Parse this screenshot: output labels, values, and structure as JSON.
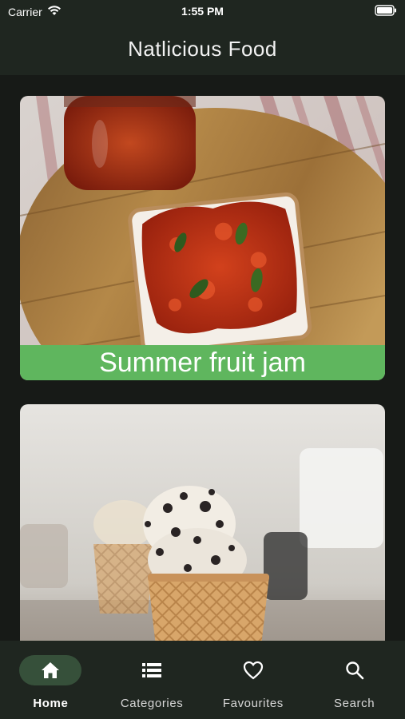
{
  "status_bar": {
    "carrier": "Carrier",
    "time": "1:55 PM"
  },
  "app_bar": {
    "title": "Natlicious Food"
  },
  "recipes": [
    {
      "title": "Summer fruit jam",
      "image": "strawberry-jam-toast-photo"
    },
    {
      "title": "",
      "image": "cookies-and-cream-ice-cream-cone-photo"
    }
  ],
  "bottom_nav": {
    "items": [
      {
        "label": "Home",
        "icon": "home-icon",
        "active": true
      },
      {
        "label": "Categories",
        "icon": "list-icon",
        "active": false
      },
      {
        "label": "Favourites",
        "icon": "heart-icon",
        "active": false
      },
      {
        "label": "Search",
        "icon": "search-icon",
        "active": false
      }
    ]
  },
  "colors": {
    "accent": "#5fb65e",
    "bar": "#1f2620",
    "background": "#171a17",
    "nav_active": "#36503a"
  }
}
